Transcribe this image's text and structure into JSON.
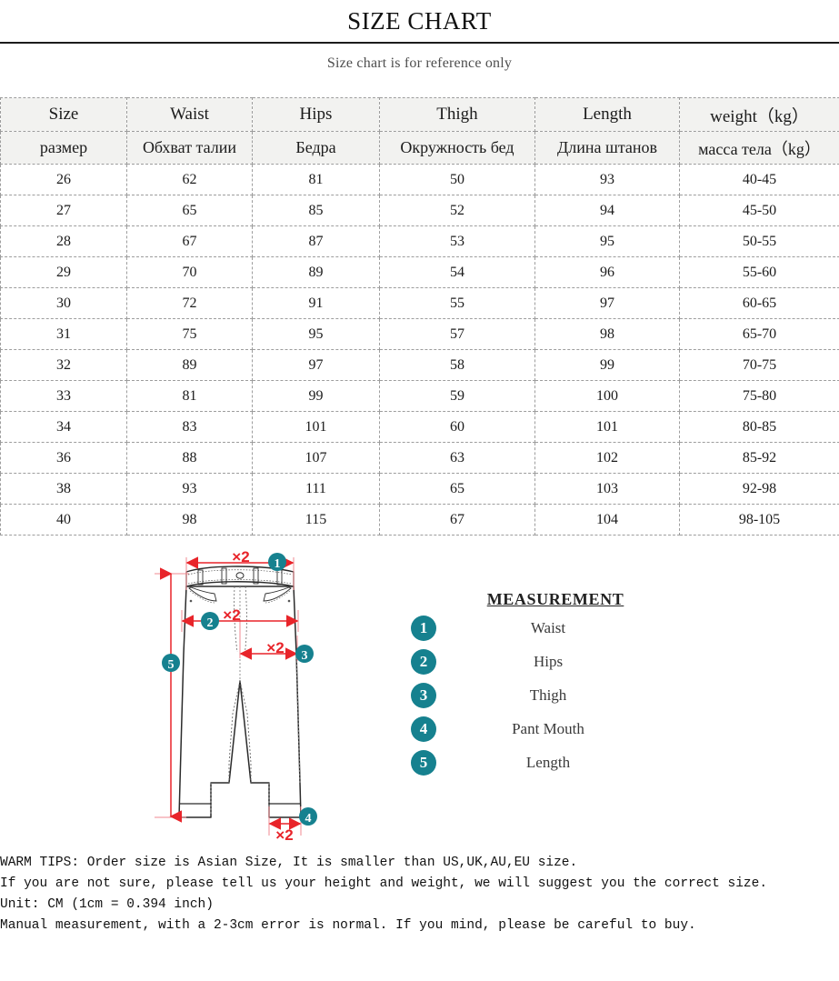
{
  "header": {
    "title": "SIZE CHART",
    "subtitle": "Size chart is for reference only"
  },
  "table": {
    "headers_en": [
      "Size",
      "Waist",
      "Hips",
      "Thigh",
      "Length",
      "weight（kg）"
    ],
    "headers_ru": [
      "размер",
      "Обхват талии",
      "Бедра",
      "Окружность бед",
      "Длина штанов",
      "масса тела（kg）"
    ],
    "rows": [
      [
        "26",
        "62",
        "81",
        "50",
        "93",
        "40-45"
      ],
      [
        "27",
        "65",
        "85",
        "52",
        "94",
        "45-50"
      ],
      [
        "28",
        "67",
        "87",
        "53",
        "95",
        "50-55"
      ],
      [
        "29",
        "70",
        "89",
        "54",
        "96",
        "55-60"
      ],
      [
        "30",
        "72",
        "91",
        "55",
        "97",
        "60-65"
      ],
      [
        "31",
        "75",
        "95",
        "57",
        "98",
        "65-70"
      ],
      [
        "32",
        "89",
        "97",
        "58",
        "99",
        "70-75"
      ],
      [
        "33",
        "81",
        "99",
        "59",
        "100",
        "75-80"
      ],
      [
        "34",
        "83",
        "101",
        "60",
        "101",
        "80-85"
      ],
      [
        "36",
        "88",
        "107",
        "63",
        "102",
        "85-92"
      ],
      [
        "38",
        "93",
        "111",
        "65",
        "103",
        "92-98"
      ],
      [
        "40",
        "98",
        "115",
        "67",
        "104",
        "98-105"
      ]
    ]
  },
  "diagram": {
    "multiplier_label": "×2",
    "badges": [
      "1",
      "2",
      "3",
      "4",
      "5"
    ]
  },
  "legend": {
    "title": "MEASUREMENT",
    "items": [
      {
        "num": "1",
        "label": "Waist"
      },
      {
        "num": "2",
        "label": "Hips"
      },
      {
        "num": "3",
        "label": "Thigh"
      },
      {
        "num": "4",
        "label": "Pant Mouth"
      },
      {
        "num": "5",
        "label": "Length"
      }
    ]
  },
  "tips": {
    "line1": "WARM TIPS: Order size is Asian Size, It is smaller than US,UK,AU,EU size.",
    "line2": "If you are not sure, please tell us your height and weight, we will suggest you the correct size.",
    "line3": "Unit: CM (1cm = 0.394 inch)",
    "line4": "Manual measurement, with a 2-3cm error is normal. If you mind, please be careful to buy."
  },
  "colors": {
    "badge_teal": "#16818f",
    "arrow_red": "#e8242a",
    "guide_pink": "#f08a90",
    "header_bg": "#f2f2f0",
    "border_dash": "#9d9d9d"
  }
}
